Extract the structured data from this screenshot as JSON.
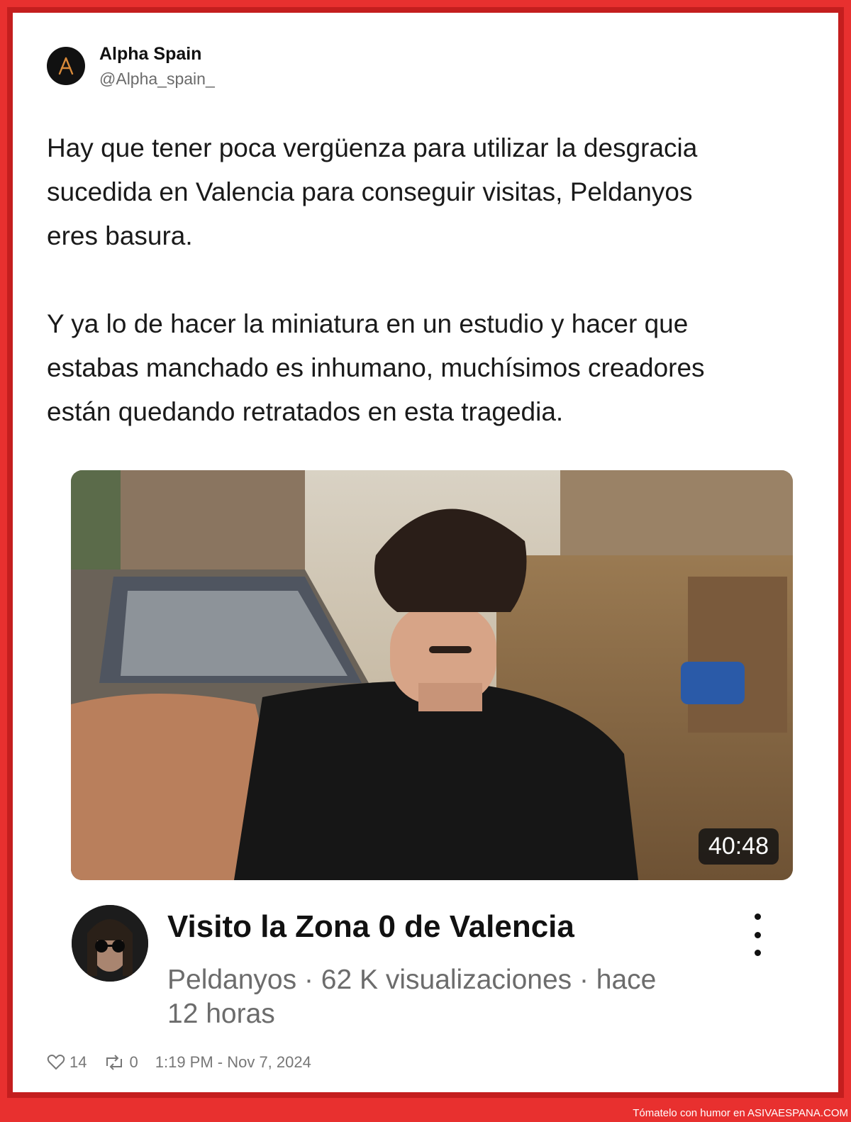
{
  "tweet": {
    "author_name": "Alpha Spain",
    "author_handle": "@Alpha_spain_",
    "text": "Hay que tener poca vergüenza para utilizar la desgracia\nsucedida en Valencia para conseguir visitas, Peldanyos\neres basura.\n\nY ya lo de hacer la miniatura en un estudio y hacer que\nestabas manchado es inhumano, muchísimos creadores\nestán quedando retratados en esta tragedia.",
    "likes": "14",
    "retweets": "0",
    "timestamp": "1:19 PM - Nov 7, 2024"
  },
  "video": {
    "duration": "40:48",
    "title": "Visito la Zona 0 de Valencia",
    "meta": "Peldanyos · 62 K visualizaciones · hace\n12 horas"
  },
  "watermark": {
    "prefix": "Tómatelo con humor en",
    "site": "ASIVAESPANA.COM"
  },
  "colors": {
    "frame": "#e8302f",
    "frame_border": "#c41e1e",
    "author_logo": "#d98a3a"
  },
  "icons": [
    "heart-icon",
    "retweet-icon",
    "more-vertical-icon"
  ]
}
